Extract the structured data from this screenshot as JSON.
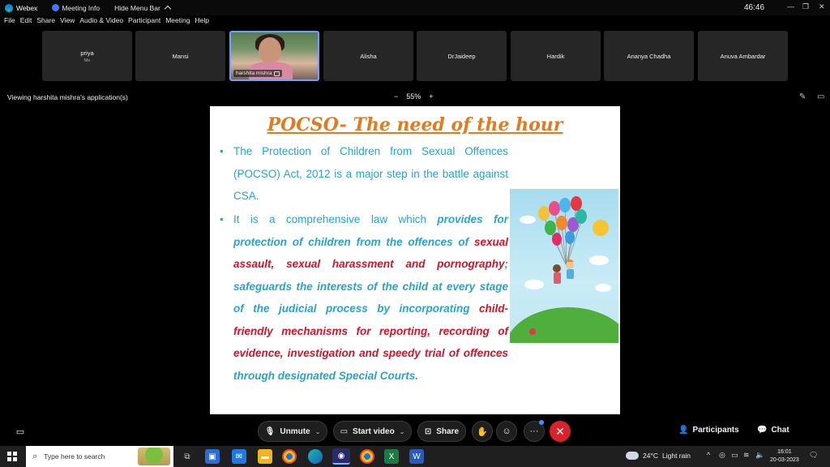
{
  "titlebar": {
    "app_name": "Webex",
    "meeting_info": "Meeting Info",
    "hide_menu_bar": "Hide Menu Bar",
    "timer": "46:46"
  },
  "menu": [
    "File",
    "Edit",
    "Share",
    "View",
    "Audio & Video",
    "Participant",
    "Meeting",
    "Help"
  ],
  "participants": [
    {
      "name": "priya",
      "sub": "Me"
    },
    {
      "name": "Mansi"
    },
    {
      "name": "harshita mishra",
      "video": true
    },
    {
      "name": "Alisha"
    },
    {
      "name": "DrJaideep"
    },
    {
      "name": "Hardik"
    },
    {
      "name": "Ananya Chadha"
    },
    {
      "name": "Anuva Ambardar"
    }
  ],
  "share_bar": {
    "viewing": "Viewing harshita mishra's application(s)",
    "zoom_minus": "−",
    "zoom_level": "55%",
    "zoom_plus": "+"
  },
  "slide": {
    "title": "POCSO- The need of the hour",
    "b1": "The Protection of Children from Sexual Offences (POCSO) Act, 2012 is a major step in the battle against CSA.",
    "b2_plain1": "It is a comprehensive law which ",
    "b2_blue1": "provides for protection of children from the offences of ",
    "b2_red1": "sexual assault, sexual harassment and pornography",
    "b2_plain2": "; ",
    "b2_blue2": "safeguards the interests of the child at every stage of the judicial process by incorporating ",
    "b2_red2": "child-friendly mechanisms for reporting, recording of evidence, investigation and speedy trial of offences",
    "b2_blue3": " through designated Special Courts."
  },
  "controls": {
    "unmute": "Unmute",
    "start_video": "Start video",
    "share": "Share",
    "participants": "Participants",
    "chat": "Chat"
  },
  "taskbar": {
    "search_placeholder": "Type here to search",
    "weather_temp": "24°C",
    "weather_desc": "Light rain",
    "time": "16:01",
    "date": "20-03-2023"
  }
}
